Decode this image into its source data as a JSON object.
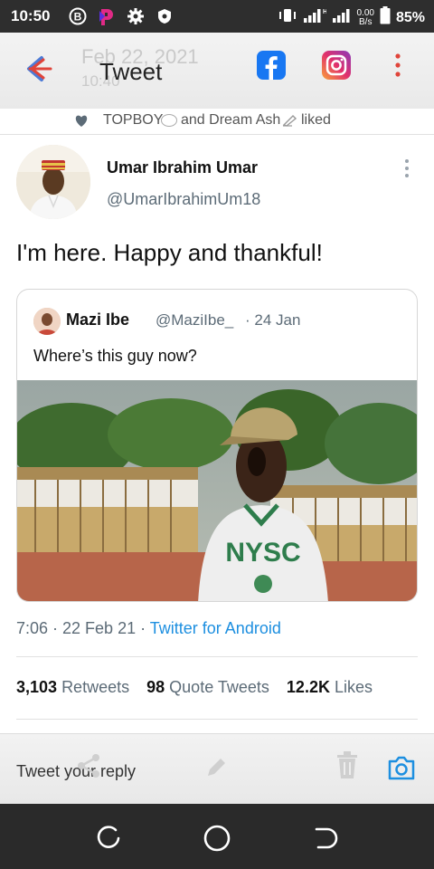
{
  "status_bar": {
    "time": "10:50",
    "speed_value": "0.00",
    "speed_unit": "B/s",
    "battery": "85%",
    "icons": [
      "bitcoin-icon",
      "p-app-icon",
      "gear-icon",
      "shield-icon",
      "vibrate-icon",
      "signal-icon",
      "signal-icon",
      "battery-icon"
    ]
  },
  "header": {
    "overlay_date": "Feb 22, 2021",
    "overlay_time": "10:40",
    "title": "Tweet",
    "icons": [
      "back-arrow-icon",
      "facebook-icon",
      "instagram-icon",
      "more-vertical-icon"
    ]
  },
  "liked_line": {
    "user1": "TOPBOY",
    "connector": "and Dream Ash",
    "suffix": "liked"
  },
  "tweet": {
    "author_name": "Umar Ibrahim Umar",
    "author_handle": "@UmarIbrahimUm18",
    "text": "I'm here. Happy and thankful!",
    "quoted": {
      "name": "Mazi Ibe",
      "handle": "@MaziIbe_",
      "date": "· 24 Jan",
      "text": "Where’s this guy now?",
      "image_shirt_text": "NYSC"
    },
    "time": "7:06 · 22 Feb 21 ·",
    "source": "Twitter for Android",
    "stats": {
      "retweets_count": "3,103",
      "retweets_label": "Retweets",
      "quotes_count": "98",
      "quotes_label": "Quote Tweets",
      "likes_count": "12.2K",
      "likes_label": "Likes"
    }
  },
  "reply": {
    "placeholder": "Tweet your reply"
  },
  "colors": {
    "link": "#1d8fe0",
    "muted": "#5c6b77",
    "back_arrow": "#e0443a",
    "facebook": "#1877f2",
    "instagram": "#e1306c"
  }
}
